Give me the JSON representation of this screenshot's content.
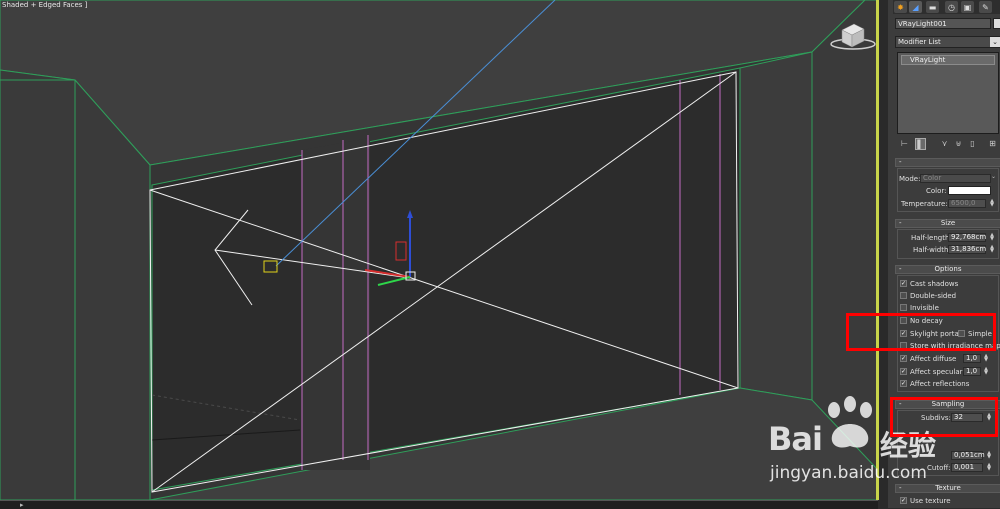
{
  "viewport": {
    "label": "Shaded + Edged Faces ]"
  },
  "command_panel": {
    "tabs": [
      {
        "name": "create",
        "glyph": "✸"
      },
      {
        "name": "modify",
        "glyph": "◢"
      },
      {
        "name": "hierarchy",
        "glyph": "▬"
      },
      {
        "name": "motion",
        "glyph": "◷"
      },
      {
        "name": "display",
        "glyph": "▣"
      },
      {
        "name": "utilities",
        "glyph": "✎"
      }
    ],
    "object_name": "VRayLight001",
    "modifier_list": "Modifier List",
    "stack_item": "VRayLight",
    "intensity": {
      "mode_label": "Mode:",
      "mode_value": "Color",
      "color_label": "Color:",
      "temperature_label": "Temperature:",
      "temperature_value": "6500,0"
    },
    "size": {
      "title": "Size",
      "half_length_label": "Half-length:",
      "half_length_value": "92,768cm",
      "half_width_label": "Half-width:",
      "half_width_value": "31,836cm"
    },
    "options": {
      "title": "Options",
      "cast_shadows": "Cast shadows",
      "double_sided": "Double-sided",
      "invisible": "Invisible",
      "no_decay": "No decay",
      "skylight_portal": "Skylight portal",
      "simple": "Simple",
      "store_irradiance": "Store with irradiance map",
      "affect_diffuse": "Affect diffuse",
      "affect_diffuse_value": "1,0",
      "affect_specular": "Affect specular",
      "affect_specular_value": "1,0",
      "affect_reflections": "Affect reflections"
    },
    "sampling": {
      "title": "Sampling",
      "subdivs_label": "Subdivs:",
      "subdivs_value": "32",
      "shadow_bias_value": "0,051cm",
      "cutoff_label": "Cutoff:",
      "cutoff_value": "0,001"
    },
    "texture": {
      "title": "Texture",
      "use_texture": "Use texture"
    }
  },
  "watermark": {
    "brand": "Bai",
    "brand_cn": "经验",
    "url": "jingyan.baidu.com"
  },
  "colors": {
    "viewport_bg": "#3e3e3e",
    "wire_green": "#2f9e5a",
    "wire_pink": "#c46bc4",
    "highlight_red": "#ff0000",
    "selection_yellow": "#c8d44a"
  }
}
